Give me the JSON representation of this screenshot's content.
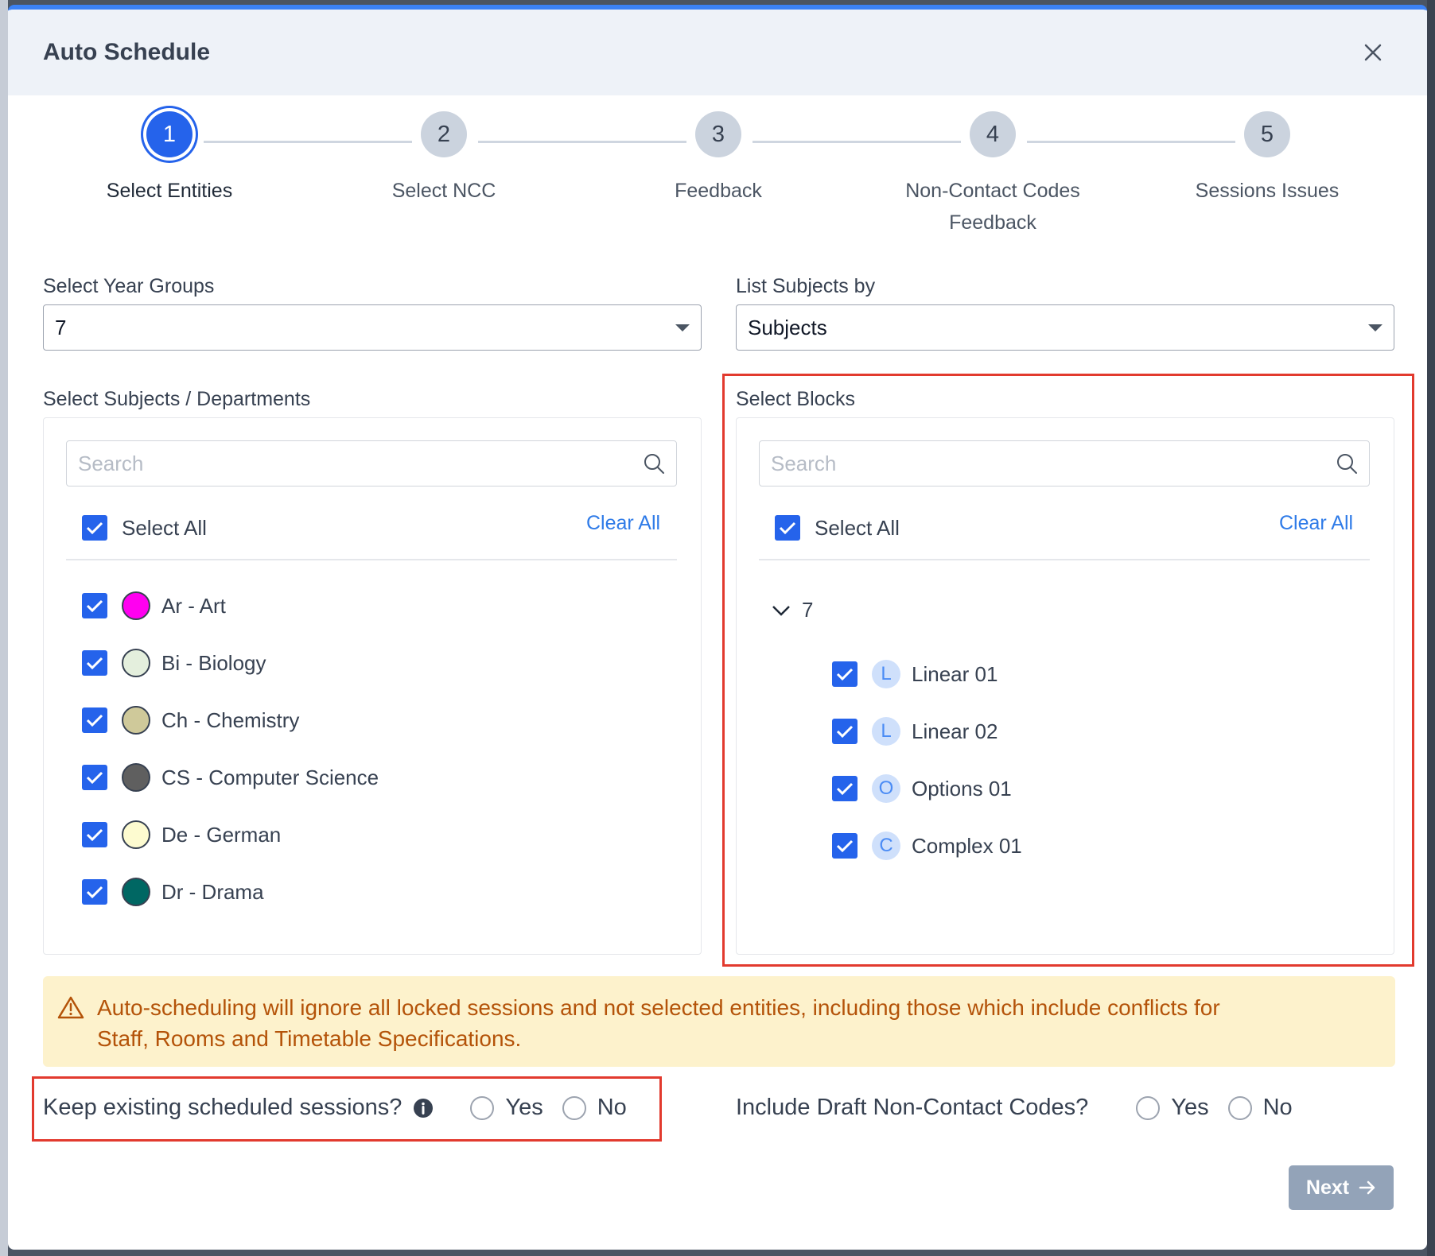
{
  "modal": {
    "title": "Auto Schedule"
  },
  "steps": [
    {
      "number": "1",
      "label": "Select Entities",
      "active": true
    },
    {
      "number": "2",
      "label": "Select NCC"
    },
    {
      "number": "3",
      "label": "Feedback"
    },
    {
      "number": "4",
      "label_line1": "Non-Contact Codes",
      "label_line2": "Feedback"
    },
    {
      "number": "5",
      "label": "Sessions Issues"
    }
  ],
  "year_groups": {
    "label": "Select Year Groups",
    "value": "7"
  },
  "list_by": {
    "label": "List Subjects by",
    "value": "Subjects"
  },
  "subjects": {
    "label": "Select Subjects / Departments",
    "search_placeholder": "Search",
    "select_all": "Select All",
    "clear_all": "Clear All",
    "items": [
      {
        "label": "Ar - Art",
        "color": "#ff00f0"
      },
      {
        "label": "Bi - Biology",
        "color": "#e4efdd"
      },
      {
        "label": "Ch - Chemistry",
        "color": "#cfc99a"
      },
      {
        "label": "CS - Computer Science",
        "color": "#5f5f5f"
      },
      {
        "label": "De - German",
        "color": "#fdfbd0"
      },
      {
        "label": "Dr - Drama",
        "color": "#006763"
      }
    ]
  },
  "blocks": {
    "label": "Select Blocks",
    "search_placeholder": "Search",
    "select_all": "Select All",
    "clear_all": "Clear All",
    "group": "7",
    "items": [
      {
        "badge": "L",
        "label": "Linear 01"
      },
      {
        "badge": "L",
        "label": "Linear 02"
      },
      {
        "badge": "O",
        "label": "Options 01"
      },
      {
        "badge": "C",
        "label": "Complex 01"
      }
    ]
  },
  "warning": {
    "line1": "Auto-scheduling will ignore all locked sessions and not selected entities, including those which include conflicts for",
    "line2": "Staff, Rooms and Timetable Specifications."
  },
  "keep_existing": {
    "question": "Keep existing scheduled sessions?",
    "yes": "Yes",
    "no": "No"
  },
  "include_draft": {
    "question": "Include Draft Non-Contact Codes?",
    "yes": "Yes",
    "no": "No"
  },
  "next_button": {
    "label": "Next"
  },
  "colors": {
    "accent": "#2563eb",
    "warning_bg": "#fdf2cc",
    "warning_text": "#b45309",
    "highlight": "#e23a2e"
  }
}
